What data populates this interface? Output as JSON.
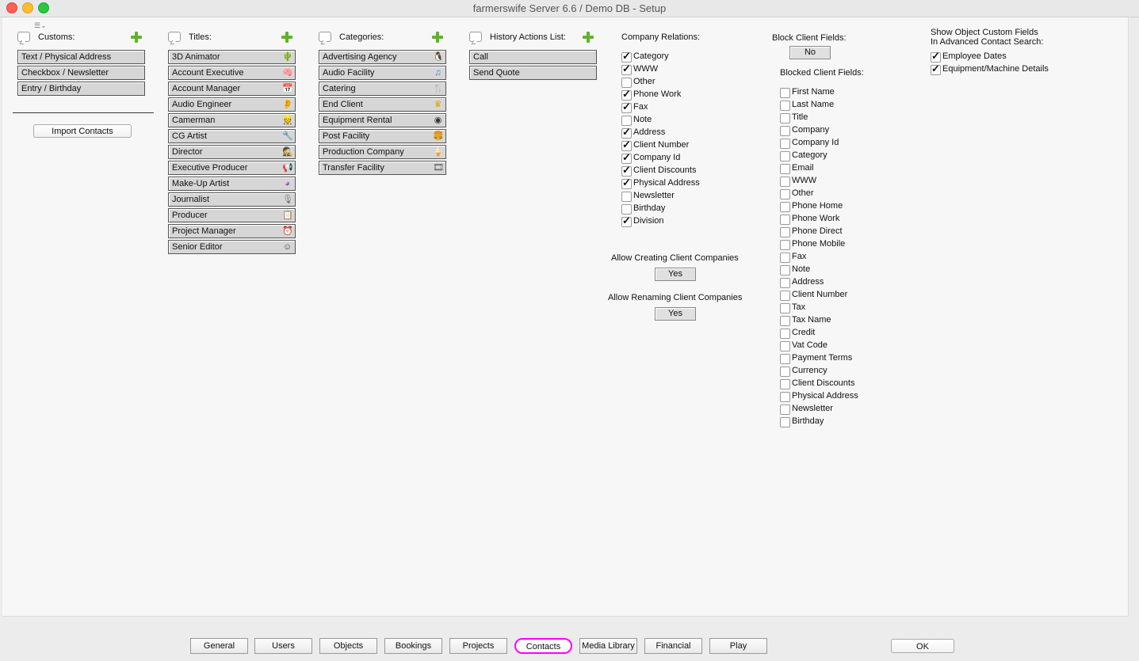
{
  "window": {
    "title": "farmerswife Server 6.6  / Demo DB - Setup"
  },
  "customs": {
    "label": "Customs:",
    "items": [
      "Text / Physical Address",
      "Checkbox / Newsletter",
      "Entry / Birthday"
    ],
    "import_button": "Import Contacts"
  },
  "titles": {
    "label": "Titles:",
    "items": [
      {
        "label": "3D Animator",
        "icon": "cactus-icon"
      },
      {
        "label": "Account Executive",
        "icon": "brain-icon"
      },
      {
        "label": "Account Manager",
        "icon": "calendar-icon"
      },
      {
        "label": "Audio Engineer",
        "icon": "ear-icon"
      },
      {
        "label": "Camerman",
        "icon": "person-icon"
      },
      {
        "label": "CG Artist",
        "icon": "drill-icon"
      },
      {
        "label": "Director",
        "icon": "spy-icon"
      },
      {
        "label": "Executive Producer",
        "icon": "megaphone-icon"
      },
      {
        "label": "Make-Up Artist",
        "icon": "color-wheel-icon"
      },
      {
        "label": "Journalist",
        "icon": "microphone-icon"
      },
      {
        "label": "Producer",
        "icon": "clipboard-icon"
      },
      {
        "label": "Project Manager",
        "icon": "alarm-clock-icon"
      },
      {
        "label": "Senior Editor",
        "icon": "face-icon"
      }
    ]
  },
  "categories": {
    "label": "Categories:",
    "items": [
      {
        "label": "Advertising Agency",
        "icon": "penguin-icon"
      },
      {
        "label": "Audio Facility",
        "icon": "music-note-icon"
      },
      {
        "label": "Catering",
        "icon": "cutlery-icon"
      },
      {
        "label": "End Client",
        "icon": "crown-icon"
      },
      {
        "label": "Equipment Rental",
        "icon": "lens-icon"
      },
      {
        "label": "Post Facility",
        "icon": "burger-icon"
      },
      {
        "label": "Production Company",
        "icon": "ice-cream-icon"
      },
      {
        "label": "Transfer Facility",
        "icon": "film-icon"
      }
    ]
  },
  "history": {
    "label": "History Actions List:",
    "items": [
      "Call",
      "Send Quote"
    ]
  },
  "company_relations": {
    "label": "Company Relations:",
    "items": [
      {
        "label": "Category",
        "checked": true
      },
      {
        "label": "WWW",
        "checked": true
      },
      {
        "label": "Other",
        "checked": false
      },
      {
        "label": "Phone Work",
        "checked": true
      },
      {
        "label": "Fax",
        "checked": true
      },
      {
        "label": "Note",
        "checked": false
      },
      {
        "label": "Address",
        "checked": true
      },
      {
        "label": "Client Number",
        "checked": true
      },
      {
        "label": "Company Id",
        "checked": true
      },
      {
        "label": "Client Discounts",
        "checked": true
      },
      {
        "label": "Physical Address",
        "checked": true
      },
      {
        "label": "Newsletter",
        "checked": false
      },
      {
        "label": "Birthday",
        "checked": false
      },
      {
        "label": "Division",
        "checked": true
      }
    ],
    "allow_creating_label": "Allow Creating Client Companies",
    "allow_creating_value": "Yes",
    "allow_renaming_label": "Allow Renaming Client Companies",
    "allow_renaming_value": "Yes"
  },
  "block_client": {
    "label": "Block Client Fields:",
    "value": "No",
    "blocked_label": "Blocked Client Fields:",
    "items": [
      {
        "label": "First Name",
        "checked": false
      },
      {
        "label": "Last Name",
        "checked": false
      },
      {
        "label": "Title",
        "checked": false
      },
      {
        "label": "Company",
        "checked": false
      },
      {
        "label": "Company Id",
        "checked": false
      },
      {
        "label": "Category",
        "checked": false
      },
      {
        "label": "Email",
        "checked": false
      },
      {
        "label": "WWW",
        "checked": false
      },
      {
        "label": "Other",
        "checked": false
      },
      {
        "label": "Phone Home",
        "checked": false
      },
      {
        "label": "Phone Work",
        "checked": false
      },
      {
        "label": "Phone Direct",
        "checked": false
      },
      {
        "label": "Phone Mobile",
        "checked": false
      },
      {
        "label": "Fax",
        "checked": false
      },
      {
        "label": "Note",
        "checked": false
      },
      {
        "label": "Address",
        "checked": false
      },
      {
        "label": "Client Number",
        "checked": false
      },
      {
        "label": "Tax",
        "checked": false
      },
      {
        "label": "Tax Name",
        "checked": false
      },
      {
        "label": "Credit",
        "checked": false
      },
      {
        "label": "Vat Code",
        "checked": false
      },
      {
        "label": "Payment Terms",
        "checked": false
      },
      {
        "label": "Currency",
        "checked": false
      },
      {
        "label": "Client Discounts",
        "checked": false
      },
      {
        "label": "Physical Address",
        "checked": false
      },
      {
        "label": "Newsletter",
        "checked": false
      },
      {
        "label": "Birthday",
        "checked": false
      }
    ]
  },
  "object_custom": {
    "label_line1": "Show Object Custom Fields",
    "label_line2": "In Advanced Contact Search:",
    "items": [
      {
        "label": "Employee Dates",
        "checked": true
      },
      {
        "label": "Equipment/Machine Details",
        "checked": true
      }
    ]
  },
  "bottom_tabs": [
    {
      "label": "General",
      "active": false
    },
    {
      "label": "Users",
      "active": false
    },
    {
      "label": "Objects",
      "active": false
    },
    {
      "label": "Bookings",
      "active": false
    },
    {
      "label": "Projects",
      "active": false
    },
    {
      "label": "Contacts",
      "active": true
    },
    {
      "label": "Media Library",
      "active": false
    },
    {
      "label": "Financial",
      "active": false
    },
    {
      "label": "Play",
      "active": false
    }
  ],
  "ok_button": "OK",
  "colors": {
    "accent_plus": "#5fb32c",
    "active_tab_outline": "#ff00ff"
  }
}
